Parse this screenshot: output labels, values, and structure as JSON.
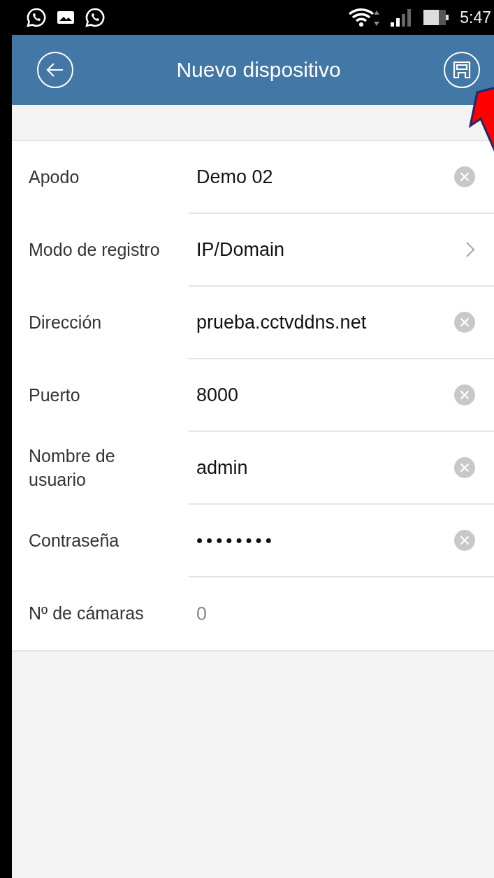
{
  "status_bar": {
    "time": "5:47"
  },
  "app_bar": {
    "title": "Nuevo dispositivo"
  },
  "fields": [
    {
      "kind": "clearable",
      "label": "Apodo",
      "value": "Demo 02"
    },
    {
      "kind": "select",
      "label": "Modo de registro",
      "value": "IP/Domain"
    },
    {
      "kind": "clearable",
      "label": "Dirección",
      "value": "prueba.cctvddns.net"
    },
    {
      "kind": "clearable",
      "label": "Puerto",
      "value": "8000"
    },
    {
      "kind": "clearable",
      "label": "Nombre de usuario",
      "value": "admin"
    },
    {
      "kind": "password",
      "label": "Contraseña",
      "value": "••••••••"
    },
    {
      "kind": "readonly",
      "label": "Nº de cámaras",
      "value": "0"
    }
  ]
}
